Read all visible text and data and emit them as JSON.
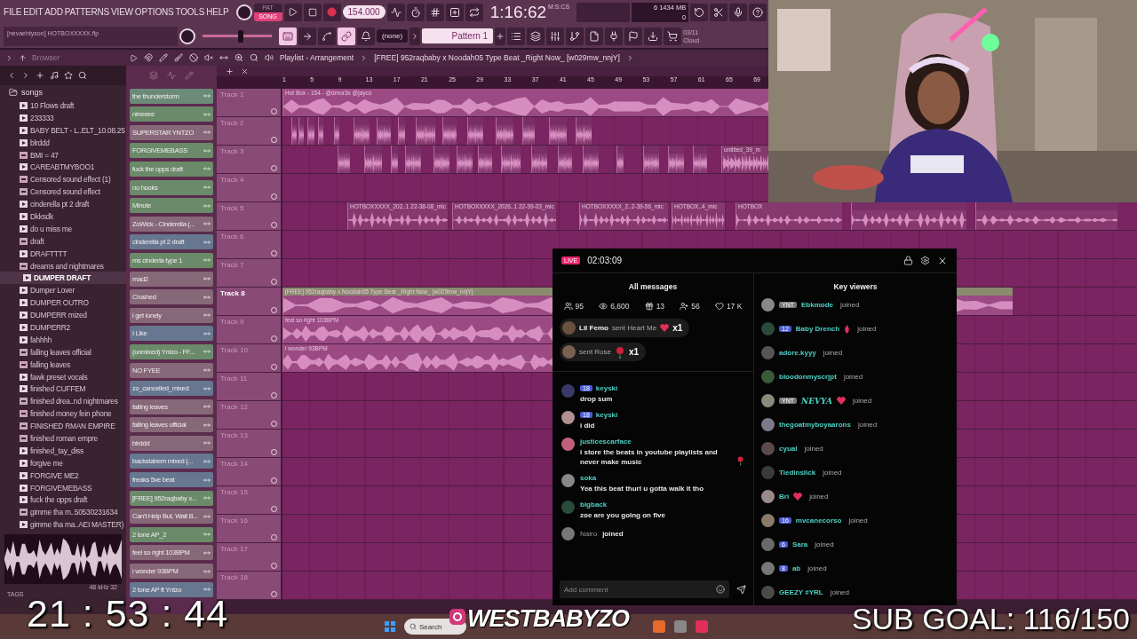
{
  "menu": [
    "FILE",
    "EDIT",
    "ADD",
    "PATTERNS",
    "VIEW",
    "OPTIONS",
    "TOOLS",
    "HELP"
  ],
  "mode_toggle": [
    {
      "label": "PAT",
      "selected": false
    },
    {
      "label": "SONG",
      "selected": true
    }
  ],
  "tempo": "154.000",
  "time": {
    "value": "1:16:62",
    "unit": "M:S:CS"
  },
  "resources": {
    "top_value": "6",
    "memory": "1434 MB",
    "bottom_value": "0"
  },
  "hint": "[nevaehtyson] HOTBOXXXXX.flp",
  "master_slider": {
    "level": 0.55
  },
  "pattern_picker": {
    "value": "(none)"
  },
  "pattern": "Pattern 1",
  "cloud": {
    "date": "03/11",
    "label": "Cloud"
  },
  "browser": {
    "title": "Browser",
    "folder": "songs",
    "items": [
      {
        "label": "10 Flows draft",
        "kind": "project",
        "selected": false
      },
      {
        "label": "233333",
        "kind": "project",
        "selected": false
      },
      {
        "label": "BABY BELT - L..ELT_10.08.25",
        "kind": "project",
        "selected": false
      },
      {
        "label": "blrddd",
        "kind": "project",
        "selected": false
      },
      {
        "label": "BMI = 47",
        "kind": "audio",
        "selected": false
      },
      {
        "label": "CAREABTMYBOO1",
        "kind": "project",
        "selected": false
      },
      {
        "label": "Censored sound effect (1)",
        "kind": "audio",
        "selected": false
      },
      {
        "label": "Censored sound effect",
        "kind": "audio",
        "selected": false
      },
      {
        "label": "cinderella pt 2 draft",
        "kind": "project",
        "selected": false
      },
      {
        "label": "Dkksdk",
        "kind": "project",
        "selected": false
      },
      {
        "label": "do u miss me",
        "kind": "project",
        "selected": false
      },
      {
        "label": "draft",
        "kind": "audio",
        "selected": false
      },
      {
        "label": "DRAFTTTT",
        "kind": "project",
        "selected": false
      },
      {
        "label": "dreams and nightmares",
        "kind": "audio",
        "selected": false
      },
      {
        "label": "DUMPER DRAFT",
        "kind": "project",
        "selected": true
      },
      {
        "label": "Dumper Lover",
        "kind": "project",
        "selected": false
      },
      {
        "label": "DUMPER OUTRO",
        "kind": "project",
        "selected": false
      },
      {
        "label": "DUMPERR mized",
        "kind": "project",
        "selected": false
      },
      {
        "label": "DUMPERR2",
        "kind": "project",
        "selected": false
      },
      {
        "label": "fahhhh",
        "kind": "project",
        "selected": false
      },
      {
        "label": "falling leaves official",
        "kind": "audio",
        "selected": false
      },
      {
        "label": "falling leaves",
        "kind": "audio",
        "selected": false
      },
      {
        "label": "fawk preset vocals",
        "kind": "project",
        "selected": false
      },
      {
        "label": "finished CUFFEM",
        "kind": "project",
        "selected": false
      },
      {
        "label": "finished drea..nd nightmares",
        "kind": "audio",
        "selected": false
      },
      {
        "label": "finished money fein phone",
        "kind": "audio",
        "selected": false
      },
      {
        "label": "FINISHED RMAN EMPIRE",
        "kind": "audio",
        "selected": false
      },
      {
        "label": "finished roman empre",
        "kind": "audio",
        "selected": false
      },
      {
        "label": "finished_tay_diss",
        "kind": "project",
        "selected": false
      },
      {
        "label": "forgive me",
        "kind": "project",
        "selected": false
      },
      {
        "label": "FORGIVE ME2",
        "kind": "project",
        "selected": false
      },
      {
        "label": "FORGIVEMEBASS",
        "kind": "project",
        "selected": false
      },
      {
        "label": "fuck the opps draft",
        "kind": "project",
        "selected": false
      },
      {
        "label": "gimme tha m..50530231634",
        "kind": "audio",
        "selected": false
      },
      {
        "label": "gimme tha ma..AEI MASTER)",
        "kind": "project",
        "selected": false
      }
    ],
    "preview_info": "48 kHz 32",
    "tags": "TAGS"
  },
  "channels": [
    {
      "name": "the thunderstorm",
      "color": "#6b8a78"
    },
    {
      "name": "nineeee",
      "color": "#6b8a6a"
    },
    {
      "name": "SUPERSTAR YNTZO",
      "color": "#876878"
    },
    {
      "name": "FORGIVEMEBASS",
      "color": "#6b8a6a"
    },
    {
      "name": "fuck the opps draft",
      "color": "#6b8a6a"
    },
    {
      "name": "no hooks",
      "color": "#6b8a6a"
    },
    {
      "name": "Minute",
      "color": "#6b8a6a"
    },
    {
      "name": "ZoWick - Cinderella (...",
      "color": "#876878"
    },
    {
      "name": "cinderella pt 2 draft",
      "color": "#66778f"
    },
    {
      "name": "ms cinderla type 1",
      "color": "#6b8a6a"
    },
    {
      "name": "mad2",
      "color": "#876878"
    },
    {
      "name": "Crushed",
      "color": "#876878"
    },
    {
      "name": "i get lonely",
      "color": "#876878"
    },
    {
      "name": "I Like",
      "color": "#66778f"
    },
    {
      "name": "(unmixed) Yntzo - FF...",
      "color": "#6b8a6a"
    },
    {
      "name": "NO FYEE",
      "color": "#876878"
    },
    {
      "name": "zo_cancelled_mixed",
      "color": "#66778f"
    },
    {
      "name": "falling leaves",
      "color": "#876878"
    },
    {
      "name": "falling leaves official",
      "color": "#876878"
    },
    {
      "name": "blrddd",
      "color": "#876878"
    },
    {
      "name": "backstabem mixed (...",
      "color": "#66778f"
    },
    {
      "name": "freaks 5ve beat",
      "color": "#66778f"
    },
    {
      "name": "[FREE] 952raqbaby x...",
      "color": "#6b8a6a"
    },
    {
      "name": "Can't Help But, Wait B...",
      "color": "#876878"
    },
    {
      "name": "2 tone AP_2",
      "color": "#6b8a6a"
    },
    {
      "name": "feel so right 103BPM",
      "color": "#876878"
    },
    {
      "name": "i wonder 93BPM",
      "color": "#876878"
    },
    {
      "name": "2 tone AP ft Yntzo",
      "color": "#66778f"
    }
  ],
  "playlist": {
    "title": "Playlist - Arrangement",
    "song": "[FREE] 952raqbaby x Noodah05 Type Beat _Right Now_ [w029mw_nnjY]",
    "bars": [
      "1",
      "5",
      "9",
      "13",
      "17",
      "21",
      "25",
      "29",
      "33",
      "37",
      "41",
      "45",
      "49",
      "53",
      "57",
      "61",
      "65",
      "69"
    ],
    "tracks": [
      {
        "name": "Track 1",
        "selected": false,
        "clips": [
          {
            "kind": "audio",
            "label": "Hot Box - 154 - @dmur3x @jayco"
          }
        ]
      },
      {
        "name": "Track 2",
        "selected": false,
        "clips": [
          {
            "kind": "audio"
          },
          {
            "kind": "audio"
          },
          {
            "kind": "audio"
          },
          {
            "kind": "audio"
          },
          {
            "kind": "audio"
          },
          {
            "kind": "audio"
          },
          {
            "kind": "audio"
          },
          {
            "kind": "audio"
          },
          {
            "kind": "audio"
          },
          {
            "kind": "audio"
          },
          {
            "kind": "audio"
          },
          {
            "kind": "audio"
          },
          {
            "kind": "audio"
          },
          {
            "kind": "audio"
          },
          {
            "kind": "audio"
          }
        ]
      },
      {
        "name": "Track 3",
        "selected": false,
        "clips": [
          {
            "kind": "audio"
          },
          {
            "kind": "audio"
          },
          {
            "kind": "audio"
          },
          {
            "kind": "audio"
          },
          {
            "kind": "audio"
          },
          {
            "kind": "audio"
          },
          {
            "kind": "audio"
          },
          {
            "kind": "audio"
          },
          {
            "kind": "audio"
          },
          {
            "kind": "audio"
          },
          {
            "kind": "audio"
          },
          {
            "kind": "audio"
          },
          {
            "kind": "audio"
          },
          {
            "kind": "audio"
          },
          {
            "kind": "audio"
          },
          {
            "kind": "audio",
            "label": "untitled_39_m"
          }
        ]
      },
      {
        "name": "Track 4",
        "selected": false
      },
      {
        "name": "Track 5",
        "selected": false,
        "clips": [
          {
            "kind": "audio",
            "label": "HOTBOXXXXX_202..1 22-38-08_mic"
          },
          {
            "kind": "audio",
            "label": "HOTBOXXXXX_2026..1 22-39-03_mic"
          },
          {
            "kind": "audio",
            "label": "HOTBOXXXXX_2..2-39-56_mic"
          },
          {
            "kind": "audio",
            "label": "HOTBOX..4_mic"
          },
          {
            "kind": "audio",
            "label": "HOTBOX"
          },
          {
            "kind": "audio"
          },
          {
            "kind": "audio"
          }
        ]
      },
      {
        "name": "Track 6",
        "selected": false
      },
      {
        "name": "Track 7",
        "selected": false
      },
      {
        "name": "Track 8",
        "selected": true,
        "clips": [
          {
            "kind": "audio",
            "label": "[FREE] 952raqbaby x Noodah05 Type Beat _Right Now_ [w029mw_nnjY]"
          }
        ]
      },
      {
        "name": "Track 9",
        "selected": false,
        "clips": [
          {
            "kind": "audio",
            "label": "feel so right 103BPM"
          }
        ]
      },
      {
        "name": "Track 10",
        "selected": false,
        "clips": [
          {
            "kind": "audio",
            "label": "i wonder 93BPM"
          }
        ]
      },
      {
        "name": "Track 11",
        "selected": false
      },
      {
        "name": "Track 12",
        "selected": false
      },
      {
        "name": "Track 13",
        "selected": false
      },
      {
        "name": "Track 14",
        "selected": false
      },
      {
        "name": "Track 15",
        "selected": false
      },
      {
        "name": "Track 16",
        "selected": false
      },
      {
        "name": "Track 17",
        "selected": false
      },
      {
        "name": "Track 18",
        "selected": false
      }
    ]
  },
  "live_panel": {
    "badge": "LIVE",
    "duration": "02:03:09",
    "messages": {
      "title": "All messages",
      "stats": [
        {
          "kind": "viewers",
          "value": "95"
        },
        {
          "kind": "views",
          "value": "6,600"
        },
        {
          "kind": "gifts",
          "value": "13"
        },
        {
          "kind": "followers",
          "value": "56"
        },
        {
          "kind": "likes",
          "value": "17 K"
        }
      ],
      "gifts": [
        {
          "kind": "heart",
          "user": "Lil Femo",
          "action": "sent Heart Me",
          "count": "x1"
        },
        {
          "kind": "rose",
          "action": "sent Rose",
          "count": "x1"
        }
      ],
      "items": [
        {
          "kind": "comment",
          "level": "18",
          "user": "keyski",
          "text": "drop sum"
        },
        {
          "kind": "comment",
          "level": "18",
          "user": "keyski",
          "text": "i did"
        },
        {
          "kind": "rosecomment",
          "user": "justicescarface",
          "text": "i store the beats in youtube playlists and never make music"
        },
        {
          "kind": "comment",
          "user": "soka",
          "text": "Yea this beat thurl u gotta walk it tho"
        },
        {
          "kind": "comment",
          "user": "bigback",
          "text": "zoe are you going on five"
        },
        {
          "kind": "join",
          "user": "Nairo",
          "text": "joined"
        }
      ],
      "comment_field": {
        "placeholder": "Add comment"
      }
    },
    "key_viewers": {
      "title": "Key viewers",
      "items": [
        {
          "kind": "plain",
          "user": "Ebkmode",
          "badge": {
            "kind": "tag",
            "label": "YNT"
          },
          "status": "joined"
        },
        {
          "kind": "drop",
          "user": "Baby Drench",
          "badge": {
            "kind": "level",
            "label": "12"
          },
          "status": "joined"
        },
        {
          "kind": "plain",
          "user": "adore.kyyy",
          "status": "joined"
        },
        {
          "kind": "plain",
          "user": "bloodonmyscrjpt",
          "status": "joined"
        },
        {
          "kind": "heart",
          "user": "NEVYA",
          "badge": {
            "kind": "tag",
            "label": "YNT"
          },
          "status": "joined"
        },
        {
          "kind": "plain",
          "user": "thegoatmyboyaarons",
          "status": "joined"
        },
        {
          "kind": "plain",
          "user": "cyual",
          "status": "joined"
        },
        {
          "kind": "plain",
          "user": "Tiedinslick",
          "status": "joined"
        },
        {
          "kind": "heart",
          "user": "Bri",
          "status": "joined"
        },
        {
          "kind": "plain",
          "user": "mvcanecorso",
          "badge": {
            "kind": "level",
            "label": "16"
          },
          "status": "joined"
        },
        {
          "kind": "plain",
          "user": "Sara",
          "badge": {
            "kind": "level",
            "label": "6"
          },
          "status": "joined"
        },
        {
          "kind": "plain",
          "user": "ab",
          "badge": {
            "kind": "level",
            "label": "8"
          },
          "status": "joined"
        },
        {
          "kind": "plain",
          "user": "GEEZY #YRL",
          "status": "joined"
        }
      ]
    }
  },
  "overlay": {
    "clock": "21 : 53 : 44",
    "channel": "WESTBABYZO",
    "sub_goal": "SUB GOAL: 116/150"
  },
  "taskbar": {
    "search": "Search"
  }
}
